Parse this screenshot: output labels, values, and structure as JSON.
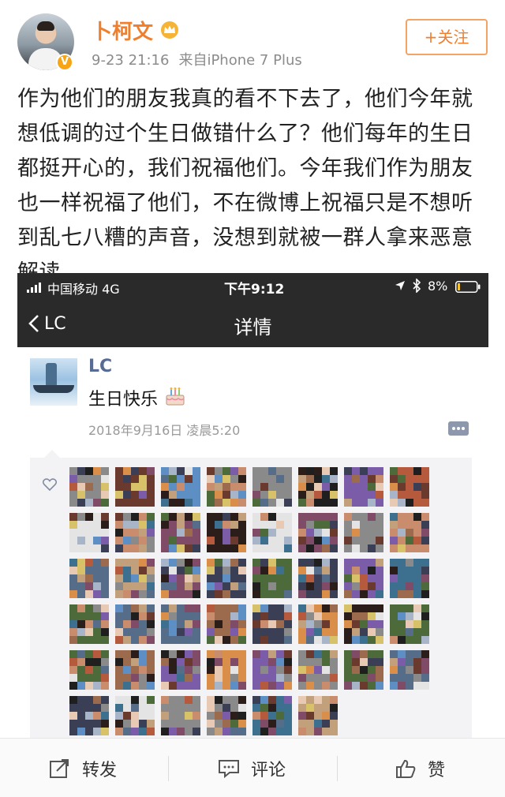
{
  "post": {
    "username": "卜柯文",
    "timestamp": "9-23 21:16",
    "source": "来自iPhone 7 Plus",
    "follow_label": "+关注",
    "text": "作为他们的朋友我真的看不下去了，他们今年就想低调的过个生日做错什么了？他们每年的生日都挺开心的，我们祝福他们。今年我们作为朋友也一样祝福了他们，不在微博上祝福只是不想听到乱七八糟的声音，没想到就被一群人拿来恶意解读。"
  },
  "embedded_screenshot": {
    "status_bar": {
      "carrier": "中国移动  4G",
      "time": "下午9:12",
      "battery": "8%"
    },
    "nav": {
      "back_label": "LC",
      "title": "详情"
    },
    "moment": {
      "author": "LC",
      "text": "生日快乐",
      "date": "2018年9月16日 凌晨5:20"
    },
    "likes_avatar_count": 46
  },
  "actions": {
    "repost_label": "转发",
    "comment_label": "评论",
    "like_label": "赞"
  },
  "icons": [
    "crown-icon",
    "verified-icon",
    "signal-icon",
    "location-icon",
    "bluetooth-icon",
    "battery-icon",
    "chevron-left-icon",
    "cake-icon",
    "more-icon",
    "heart-icon",
    "repost-icon",
    "comment-icon",
    "like-icon"
  ],
  "colors": {
    "username": "#f07f2d",
    "follow_border": "#f3a464",
    "wechat_name": "#576b95",
    "dark_bar": "#2a2a2a"
  }
}
